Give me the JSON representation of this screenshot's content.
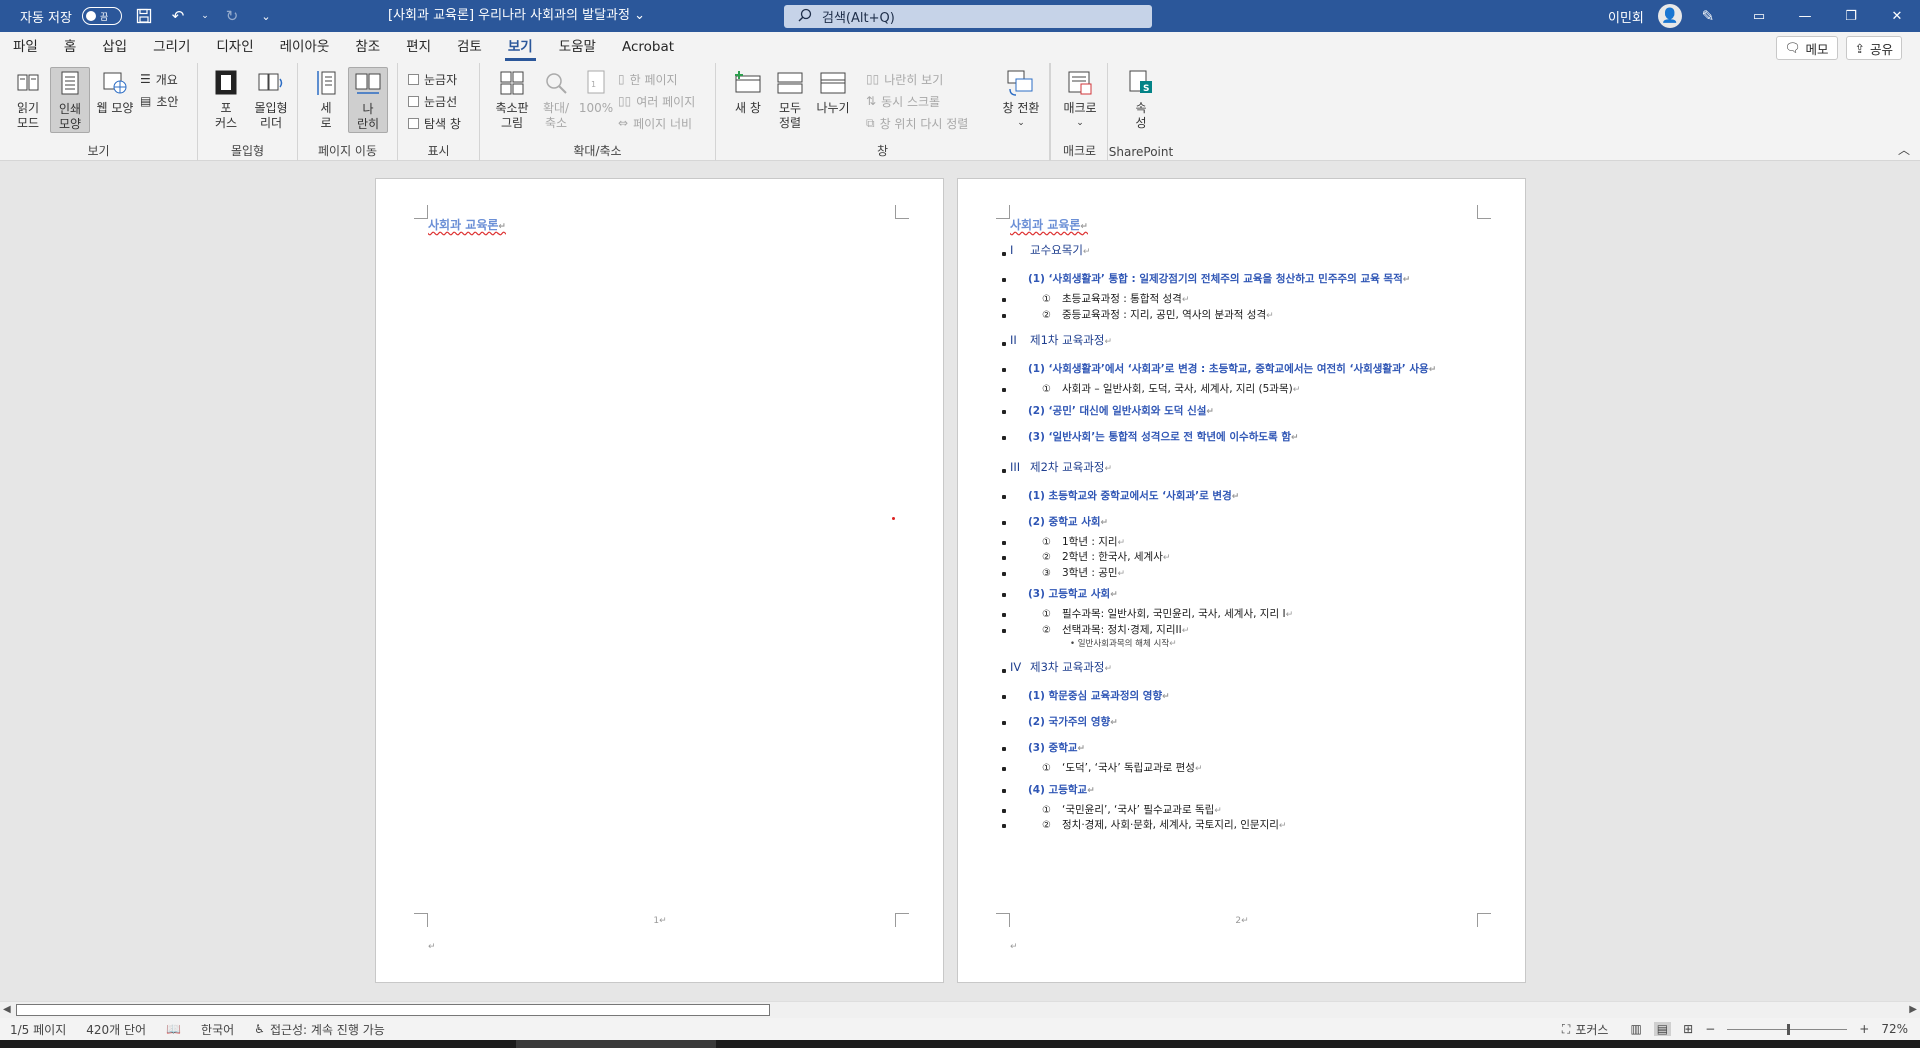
{
  "titlebar": {
    "autosave_label": "자동 저장",
    "autosave_state": "끔",
    "doc_title": "[사회과 교육론] 우리나라 사회과의 발달과정",
    "search_placeholder": "검색(Alt+Q)",
    "user_name": "이민회"
  },
  "menu": {
    "tabs": [
      "파일",
      "홈",
      "삽입",
      "그리기",
      "디자인",
      "레이아웃",
      "참조",
      "편지",
      "검토",
      "보기",
      "도움말",
      "Acrobat"
    ],
    "active_index": 9,
    "memo_label": "메모",
    "share_label": "공유"
  },
  "ribbon": {
    "views": {
      "label": "보기",
      "read_mode": [
        "읽기",
        "모드"
      ],
      "print_layout": [
        "인쇄",
        "모양"
      ],
      "web_layout": "웹 모양",
      "outline": "개요",
      "draft": "초안"
    },
    "immersive": {
      "label": "몰입형",
      "focus": [
        "포",
        "커스"
      ],
      "reader": [
        "몰입형",
        "리더"
      ]
    },
    "page_move": {
      "label": "페이지 이동",
      "vertical": [
        "세",
        "로"
      ],
      "side_by_side": [
        "나",
        "란히"
      ]
    },
    "show": {
      "label": "표시",
      "ruler": "눈금자",
      "gridlines": "눈금선",
      "nav_pane": "탐색 창"
    },
    "zoom": {
      "label": "확대/축소",
      "zoom": [
        "축소판",
        "그림"
      ],
      "zoom2": [
        "확대/",
        "축소"
      ],
      "percent": "100%",
      "one_page": "한 페이지",
      "multi_page": "여러 페이지",
      "page_width": "페이지 너비"
    },
    "window": {
      "label": "창",
      "new_window": "새 창",
      "arrange_all": [
        "모두",
        "정렬"
      ],
      "split": "나누기",
      "side_by_side": "나란히 보기",
      "sync_scroll": "동시 스크롤",
      "reset_pos": "창 위치 다시 정렬",
      "switch": "창 전환"
    },
    "macros": {
      "label": "매크로",
      "btn": "매크로"
    },
    "sharepoint": {
      "label": "SharePoint",
      "btn": [
        "속",
        "성"
      ]
    }
  },
  "page1": {
    "header": "사회과 교육론",
    "footer_num": "1"
  },
  "page2": {
    "header": "사회과 교육론",
    "footer_num": "2",
    "lines": [
      {
        "type": "h1",
        "num": "I",
        "text": "교수요목기"
      },
      {
        "type": "h2",
        "text": "(1) ‘사회생활과’ 통합 : 일제강점기의 전체주의 교육을 청산하고 민주주의 교육 목적"
      },
      {
        "type": "h3",
        "num": "①",
        "text": "초등교육과정 : 통합적 성격"
      },
      {
        "type": "h3",
        "num": "②",
        "text": "중등교육과정 : 지리, 공민, 역사의 분과적 성격"
      },
      {
        "type": "h1",
        "num": "II",
        "text": "제1차 교육과정"
      },
      {
        "type": "h2",
        "text": "(1) ‘사회생활과’에서 ‘사회과’로 변경 : 초등학교, 중학교에서는 여전히 ‘사회생활과’ 사용"
      },
      {
        "type": "h3",
        "num": "①",
        "text": "사회과 – 일반사회, 도덕, 국사, 세계사, 지리 (5과목)"
      },
      {
        "type": "h2",
        "text": "(2) ‘공민’ 대신에 일반사회와 도덕 신설"
      },
      {
        "type": "h2",
        "text": "(3) ‘일반사회’는 통합적 성격으로 전 학년에 이수하도록 함"
      },
      {
        "type": "h1",
        "num": "III",
        "text": "제2차 교육과정"
      },
      {
        "type": "h2",
        "text": "(1) 초등학교와 중학교에서도 ‘사회과’로 변경"
      },
      {
        "type": "h2",
        "text": "(2) 중학교 사회"
      },
      {
        "type": "h3",
        "num": "①",
        "text": "1학년 : 지리"
      },
      {
        "type": "h3",
        "num": "②",
        "text": "2학년 : 한국사, 세계사"
      },
      {
        "type": "h3",
        "num": "③",
        "text": "3학년 : 공민"
      },
      {
        "type": "h2",
        "text": "(3) 고등학교 사회"
      },
      {
        "type": "h3",
        "num": "①",
        "text": "필수과목: 일반사회, 국민윤리, 국사, 세계사, 지리 I"
      },
      {
        "type": "h3",
        "num": "②",
        "text": "선택과목: 정치·경제, 지리II"
      },
      {
        "type": "h4",
        "text": "일반사회과목의 해체 시작"
      },
      {
        "type": "h1",
        "num": "IV",
        "text": "제3차 교육과정"
      },
      {
        "type": "h2",
        "text": "(1) 학문중심 교육과정의 영향"
      },
      {
        "type": "h2",
        "text": "(2) 국가주의 영향"
      },
      {
        "type": "h2",
        "text": "(3) 중학교"
      },
      {
        "type": "h3",
        "num": "①",
        "text": "‘도덕’, ‘국사’ 독립교과로 편성"
      },
      {
        "type": "h2",
        "text": "(4) 고등학교"
      },
      {
        "type": "h3",
        "num": "①",
        "text": "‘국민윤리’, ‘국사’ 필수교과로 독립"
      },
      {
        "type": "h3",
        "num": "②",
        "text": "정치·경제, 사회·문화, 세계사, 국토지리, 인문지리"
      }
    ]
  },
  "status": {
    "page": "1/5 페이지",
    "words": "420개 단어",
    "language": "한국어",
    "accessibility": "접근성: 계속 진행 가능",
    "focus": "포커스",
    "zoom": "72%"
  }
}
